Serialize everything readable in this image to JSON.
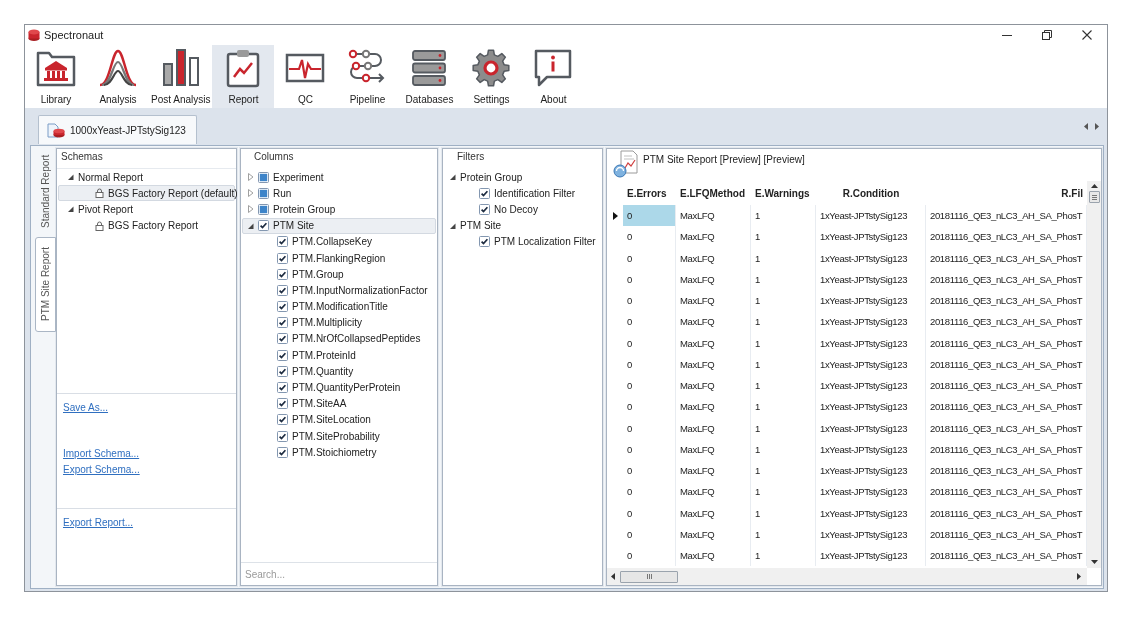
{
  "window": {
    "title": "Spectronaut"
  },
  "toolbar": [
    {
      "label": "Library",
      "selected": false
    },
    {
      "label": "Analysis",
      "selected": false
    },
    {
      "label": "Post Analysis",
      "selected": false
    },
    {
      "label": "Report",
      "selected": true
    },
    {
      "label": "QC",
      "selected": false
    },
    {
      "label": "Pipeline",
      "selected": false
    },
    {
      "label": "Databases",
      "selected": false
    },
    {
      "label": "Settings",
      "selected": false
    },
    {
      "label": "About",
      "selected": false
    }
  ],
  "document_tabs": [
    {
      "label": "1000xYeast-JPTstySig123",
      "selected": true
    }
  ],
  "report_tabs": [
    {
      "label": "Standard Report",
      "selected": false
    },
    {
      "label": "PTM Site Report",
      "selected": true
    }
  ],
  "schemas": {
    "title": "Schemas",
    "tree": [
      {
        "label": "Normal Report",
        "expanded": true,
        "selected": false,
        "children": [
          {
            "label": "BGS Factory Report (default)",
            "locked": true,
            "selected": true
          }
        ]
      },
      {
        "label": "Pivot Report",
        "expanded": true,
        "selected": false,
        "children": [
          {
            "label": "BGS Factory Report",
            "locked": true,
            "selected": false
          }
        ]
      }
    ],
    "action_panels": [
      {
        "link_groups": [
          [
            "Save As..."
          ],
          [
            "Import Schema...",
            "Export Schema..."
          ]
        ]
      },
      {
        "link_groups": [
          [
            "Export Report..."
          ]
        ]
      }
    ]
  },
  "columns": {
    "title": "Columns",
    "tree": [
      {
        "label": "Experiment",
        "checked": false,
        "indeterminate": true,
        "expanded": false,
        "selected": false
      },
      {
        "label": "Run",
        "checked": false,
        "indeterminate": true,
        "expanded": false,
        "selected": false
      },
      {
        "label": "Protein Group",
        "checked": false,
        "indeterminate": true,
        "expanded": false,
        "selected": false
      },
      {
        "label": "PTM Site",
        "checked": true,
        "indeterminate": false,
        "expanded": true,
        "selected": true,
        "children": [
          {
            "label": "PTM.CollapseKey",
            "checked": true,
            "selected": false
          },
          {
            "label": "PTM.FlankingRegion",
            "checked": true,
            "selected": false
          },
          {
            "label": "PTM.Group",
            "checked": true,
            "selected": false
          },
          {
            "label": "PTM.InputNormalizationFactor",
            "checked": true,
            "selected": false
          },
          {
            "label": "PTM.ModificationTitle",
            "checked": true,
            "selected": false
          },
          {
            "label": "PTM.Multiplicity",
            "checked": true,
            "selected": false
          },
          {
            "label": "PTM.NrOfCollapsedPeptides",
            "checked": true,
            "selected": false
          },
          {
            "label": "PTM.ProteinId",
            "checked": true,
            "selected": false
          },
          {
            "label": "PTM.Quantity",
            "checked": true,
            "selected": false
          },
          {
            "label": "PTM.QuantityPerProtein",
            "checked": true,
            "selected": false
          },
          {
            "label": "PTM.SiteAA",
            "checked": true,
            "selected": false
          },
          {
            "label": "PTM.SiteLocation",
            "checked": true,
            "selected": false
          },
          {
            "label": "PTM.SiteProbability",
            "checked": true,
            "selected": false
          },
          {
            "label": "PTM.Stoichiometry",
            "checked": true,
            "selected": false
          }
        ]
      }
    ],
    "search": {
      "placeholder": "Search..."
    }
  },
  "filters": {
    "title": "Filters",
    "tree": [
      {
        "label": "Protein Group",
        "expanded": true,
        "selected": false,
        "children": [
          {
            "label": "Identification Filter",
            "checked": true,
            "selected": false
          },
          {
            "label": "No Decoy",
            "checked": true,
            "selected": false
          }
        ]
      },
      {
        "label": "PTM Site",
        "expanded": true,
        "selected": false,
        "children": [
          {
            "label": "PTM Localization Filter",
            "checked": true,
            "selected": false
          }
        ]
      }
    ]
  },
  "report": {
    "title": "PTM Site Report [Preview] [Preview]",
    "table": {
      "columns": [
        "E.Errors",
        "E.LFQMethod",
        "E.Warnings",
        "R.Condition",
        "R.Fil"
      ],
      "rows": [
        {
          "current": true,
          "cells": [
            {
              "text": "0",
              "selected": true
            },
            {
              "text": "MaxLFQ",
              "selected": false
            },
            {
              "text": "1",
              "selected": false
            },
            {
              "text": "1xYeast-JPTstySig123",
              "selected": false
            },
            {
              "text": "20181116_QE3_nLC3_AH_SA_PhosT",
              "selected": false
            }
          ]
        },
        {
          "current": false,
          "cells": [
            {
              "text": "0",
              "selected": false
            },
            {
              "text": "MaxLFQ",
              "selected": false
            },
            {
              "text": "1",
              "selected": false
            },
            {
              "text": "1xYeast-JPTstySig123",
              "selected": false
            },
            {
              "text": "20181116_QE3_nLC3_AH_SA_PhosT",
              "selected": false
            }
          ]
        },
        {
          "current": false,
          "cells": [
            {
              "text": "0",
              "selected": false
            },
            {
              "text": "MaxLFQ",
              "selected": false
            },
            {
              "text": "1",
              "selected": false
            },
            {
              "text": "1xYeast-JPTstySig123",
              "selected": false
            },
            {
              "text": "20181116_QE3_nLC3_AH_SA_PhosT",
              "selected": false
            }
          ]
        },
        {
          "current": false,
          "cells": [
            {
              "text": "0",
              "selected": false
            },
            {
              "text": "MaxLFQ",
              "selected": false
            },
            {
              "text": "1",
              "selected": false
            },
            {
              "text": "1xYeast-JPTstySig123",
              "selected": false
            },
            {
              "text": "20181116_QE3_nLC3_AH_SA_PhosT",
              "selected": false
            }
          ]
        },
        {
          "current": false,
          "cells": [
            {
              "text": "0",
              "selected": false
            },
            {
              "text": "MaxLFQ",
              "selected": false
            },
            {
              "text": "1",
              "selected": false
            },
            {
              "text": "1xYeast-JPTstySig123",
              "selected": false
            },
            {
              "text": "20181116_QE3_nLC3_AH_SA_PhosT",
              "selected": false
            }
          ]
        },
        {
          "current": false,
          "cells": [
            {
              "text": "0",
              "selected": false
            },
            {
              "text": "MaxLFQ",
              "selected": false
            },
            {
              "text": "1",
              "selected": false
            },
            {
              "text": "1xYeast-JPTstySig123",
              "selected": false
            },
            {
              "text": "20181116_QE3_nLC3_AH_SA_PhosT",
              "selected": false
            }
          ]
        },
        {
          "current": false,
          "cells": [
            {
              "text": "0",
              "selected": false
            },
            {
              "text": "MaxLFQ",
              "selected": false
            },
            {
              "text": "1",
              "selected": false
            },
            {
              "text": "1xYeast-JPTstySig123",
              "selected": false
            },
            {
              "text": "20181116_QE3_nLC3_AH_SA_PhosT",
              "selected": false
            }
          ]
        },
        {
          "current": false,
          "cells": [
            {
              "text": "0",
              "selected": false
            },
            {
              "text": "MaxLFQ",
              "selected": false
            },
            {
              "text": "1",
              "selected": false
            },
            {
              "text": "1xYeast-JPTstySig123",
              "selected": false
            },
            {
              "text": "20181116_QE3_nLC3_AH_SA_PhosT",
              "selected": false
            }
          ]
        },
        {
          "current": false,
          "cells": [
            {
              "text": "0",
              "selected": false
            },
            {
              "text": "MaxLFQ",
              "selected": false
            },
            {
              "text": "1",
              "selected": false
            },
            {
              "text": "1xYeast-JPTstySig123",
              "selected": false
            },
            {
              "text": "20181116_QE3_nLC3_AH_SA_PhosT",
              "selected": false
            }
          ]
        },
        {
          "current": false,
          "cells": [
            {
              "text": "0",
              "selected": false
            },
            {
              "text": "MaxLFQ",
              "selected": false
            },
            {
              "text": "1",
              "selected": false
            },
            {
              "text": "1xYeast-JPTstySig123",
              "selected": false
            },
            {
              "text": "20181116_QE3_nLC3_AH_SA_PhosT",
              "selected": false
            }
          ]
        },
        {
          "current": false,
          "cells": [
            {
              "text": "0",
              "selected": false
            },
            {
              "text": "MaxLFQ",
              "selected": false
            },
            {
              "text": "1",
              "selected": false
            },
            {
              "text": "1xYeast-JPTstySig123",
              "selected": false
            },
            {
              "text": "20181116_QE3_nLC3_AH_SA_PhosT",
              "selected": false
            }
          ]
        },
        {
          "current": false,
          "cells": [
            {
              "text": "0",
              "selected": false
            },
            {
              "text": "MaxLFQ",
              "selected": false
            },
            {
              "text": "1",
              "selected": false
            },
            {
              "text": "1xYeast-JPTstySig123",
              "selected": false
            },
            {
              "text": "20181116_QE3_nLC3_AH_SA_PhosT",
              "selected": false
            }
          ]
        },
        {
          "current": false,
          "cells": [
            {
              "text": "0",
              "selected": false
            },
            {
              "text": "MaxLFQ",
              "selected": false
            },
            {
              "text": "1",
              "selected": false
            },
            {
              "text": "1xYeast-JPTstySig123",
              "selected": false
            },
            {
              "text": "20181116_QE3_nLC3_AH_SA_PhosT",
              "selected": false
            }
          ]
        },
        {
          "current": false,
          "cells": [
            {
              "text": "0",
              "selected": false
            },
            {
              "text": "MaxLFQ",
              "selected": false
            },
            {
              "text": "1",
              "selected": false
            },
            {
              "text": "1xYeast-JPTstySig123",
              "selected": false
            },
            {
              "text": "20181116_QE3_nLC3_AH_SA_PhosT",
              "selected": false
            }
          ]
        },
        {
          "current": false,
          "cells": [
            {
              "text": "0",
              "selected": false
            },
            {
              "text": "MaxLFQ",
              "selected": false
            },
            {
              "text": "1",
              "selected": false
            },
            {
              "text": "1xYeast-JPTstySig123",
              "selected": false
            },
            {
              "text": "20181116_QE3_nLC3_AH_SA_PhosT",
              "selected": false
            }
          ]
        },
        {
          "current": false,
          "cells": [
            {
              "text": "0",
              "selected": false
            },
            {
              "text": "MaxLFQ",
              "selected": false
            },
            {
              "text": "1",
              "selected": false
            },
            {
              "text": "1xYeast-JPTstySig123",
              "selected": false
            },
            {
              "text": "20181116_QE3_nLC3_AH_SA_PhosT",
              "selected": false
            }
          ]
        },
        {
          "current": false,
          "cells": [
            {
              "text": "0",
              "selected": false
            },
            {
              "text": "MaxLFQ",
              "selected": false
            },
            {
              "text": "1",
              "selected": false
            },
            {
              "text": "1xYeast-JPTstySig123",
              "selected": false
            },
            {
              "text": "20181116_QE3_nLC3_AH_SA_PhosT",
              "selected": false
            }
          ]
        }
      ]
    }
  }
}
